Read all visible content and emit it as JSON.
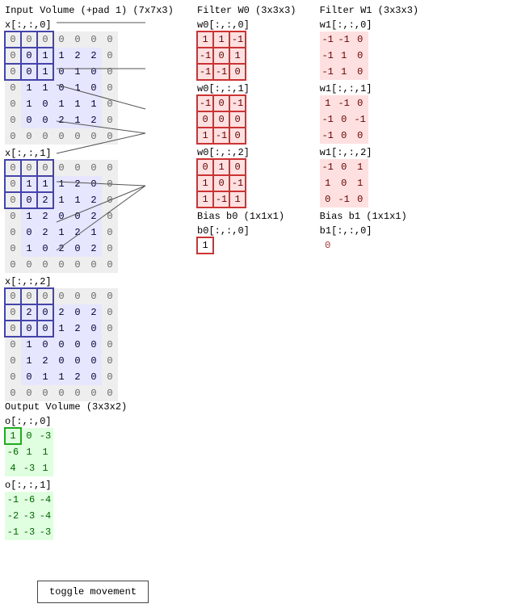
{
  "input": {
    "title": "Input Volume (+pad 1) (7x7x3)",
    "labels": [
      "x[:,:,0]",
      "x[:,:,1]",
      "x[:,:,2]"
    ],
    "slices": [
      [
        [
          0,
          0,
          0,
          0,
          0,
          0,
          0
        ],
        [
          0,
          0,
          1,
          1,
          2,
          2,
          0
        ],
        [
          0,
          0,
          1,
          0,
          1,
          0,
          0
        ],
        [
          0,
          1,
          1,
          0,
          1,
          0,
          0
        ],
        [
          0,
          1,
          0,
          1,
          1,
          1,
          0
        ],
        [
          0,
          0,
          0,
          2,
          1,
          2,
          0
        ],
        [
          0,
          0,
          0,
          0,
          0,
          0,
          0
        ]
      ],
      [
        [
          0,
          0,
          0,
          0,
          0,
          0,
          0
        ],
        [
          0,
          1,
          1,
          1,
          2,
          0,
          0
        ],
        [
          0,
          0,
          2,
          1,
          1,
          2,
          0
        ],
        [
          0,
          1,
          2,
          0,
          0,
          2,
          0
        ],
        [
          0,
          0,
          2,
          1,
          2,
          1,
          0
        ],
        [
          0,
          1,
          0,
          2,
          0,
          2,
          0
        ],
        [
          0,
          0,
          0,
          0,
          0,
          0,
          0
        ]
      ],
      [
        [
          0,
          0,
          0,
          0,
          0,
          0,
          0
        ],
        [
          0,
          2,
          0,
          2,
          0,
          2,
          0
        ],
        [
          0,
          0,
          0,
          1,
          2,
          0,
          0
        ],
        [
          0,
          1,
          0,
          0,
          0,
          0,
          0
        ],
        [
          0,
          1,
          2,
          0,
          0,
          0,
          0
        ],
        [
          0,
          0,
          1,
          1,
          2,
          0,
          0
        ],
        [
          0,
          0,
          0,
          0,
          0,
          0,
          0
        ]
      ]
    ]
  },
  "filter0": {
    "title": "Filter W0 (3x3x3)",
    "labels": [
      "w0[:,:,0]",
      "w0[:,:,1]",
      "w0[:,:,2]"
    ],
    "slices": [
      [
        [
          1,
          1,
          -1
        ],
        [
          -1,
          0,
          1
        ],
        [
          -1,
          -1,
          0
        ]
      ],
      [
        [
          -1,
          0,
          -1
        ],
        [
          0,
          0,
          0
        ],
        [
          1,
          -1,
          0
        ]
      ],
      [
        [
          0,
          1,
          0
        ],
        [
          1,
          0,
          -1
        ],
        [
          1,
          -1,
          1
        ]
      ]
    ]
  },
  "filter1": {
    "title": "Filter W1 (3x3x3)",
    "labels": [
      "w1[:,:,0]",
      "w1[:,:,1]",
      "w1[:,:,2]"
    ],
    "slices": [
      [
        [
          -1,
          -1,
          0
        ],
        [
          -1,
          1,
          0
        ],
        [
          -1,
          1,
          0
        ]
      ],
      [
        [
          1,
          -1,
          0
        ],
        [
          -1,
          0,
          -1
        ],
        [
          -1,
          0,
          0
        ]
      ],
      [
        [
          -1,
          0,
          1
        ],
        [
          1,
          0,
          1
        ],
        [
          0,
          -1,
          0
        ]
      ]
    ]
  },
  "output": {
    "title": "Output Volume (3x3x2)",
    "labels": [
      "o[:,:,0]",
      "o[:,:,1]"
    ],
    "slices": [
      [
        [
          1,
          0,
          -3
        ],
        [
          -6,
          1,
          1
        ],
        [
          4,
          -3,
          1
        ]
      ],
      [
        [
          -1,
          -6,
          -4
        ],
        [
          -2,
          -3,
          -4
        ],
        [
          -1,
          -3,
          -3
        ]
      ]
    ]
  },
  "bias0": {
    "title": "Bias b0 (1x1x1)",
    "label": "b0[:,:,0]",
    "value": 1
  },
  "bias1": {
    "title": "Bias b1 (1x1x1)",
    "label": "b1[:,:,0]",
    "value": 0
  },
  "button": "toggle movement",
  "highlight": {
    "input_rows": [
      0,
      1,
      2
    ],
    "input_cols": [
      0,
      1,
      2
    ],
    "out_row": 0,
    "out_col": 0
  }
}
